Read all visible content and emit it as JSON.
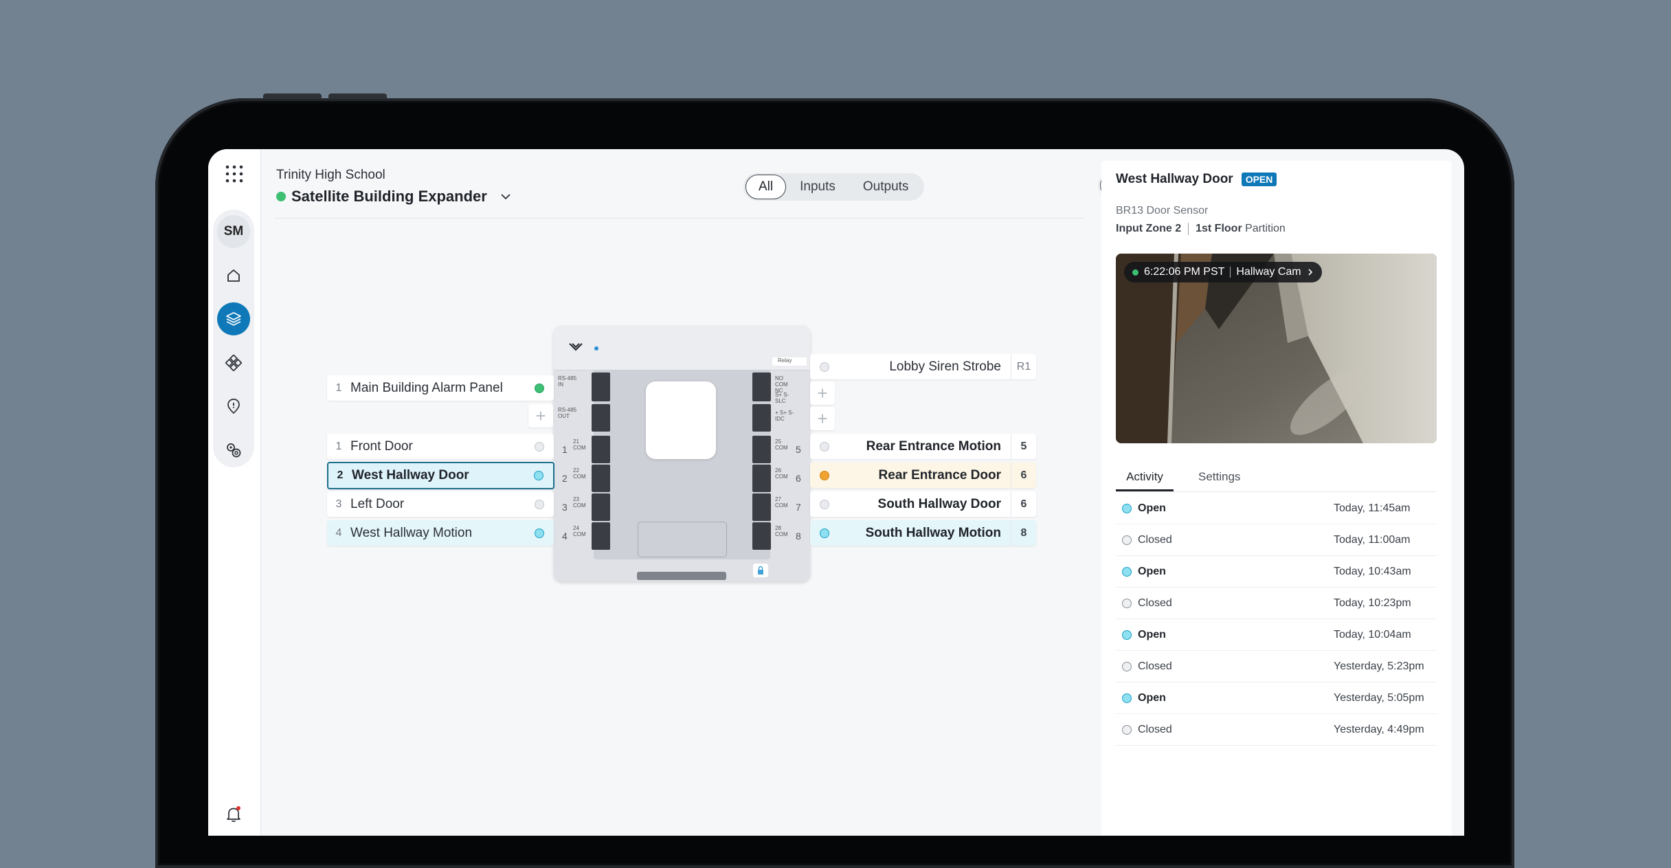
{
  "header": {
    "org_name": "Trinity High School",
    "device_name": "Satellite Building Expander",
    "status_color": "#3dbf74"
  },
  "filter_tabs": [
    {
      "label": "All",
      "active": true
    },
    {
      "label": "Inputs",
      "active": false
    },
    {
      "label": "Outputs",
      "active": false
    }
  ],
  "sidebar": {
    "avatar_initials": "SM",
    "items": [
      {
        "icon": "home-icon",
        "active": false
      },
      {
        "icon": "devices-icon",
        "active": true
      },
      {
        "icon": "integrations-icon",
        "active": false
      },
      {
        "icon": "location-icon",
        "active": false
      },
      {
        "icon": "settings-icon",
        "active": false
      }
    ]
  },
  "left_ports": [
    {
      "num": "1",
      "label": "Main Building Alarm Panel",
      "indicator": "green"
    },
    {
      "num": "1",
      "label": "Front Door",
      "indicator": "gray"
    },
    {
      "num": "2",
      "label": "West Hallway Door",
      "indicator": "cyan",
      "selected": true
    },
    {
      "num": "3",
      "label": "Left Door",
      "indicator": "gray"
    },
    {
      "num": "4",
      "label": "West Hallway Motion",
      "indicator": "cyan"
    }
  ],
  "right_ports": [
    {
      "label": "Lobby Siren Strobe",
      "tag": "R1",
      "indicator": "gray"
    },
    {
      "label": "Rear Entrance Motion",
      "tag": "5",
      "indicator": "gray"
    },
    {
      "label": "Rear Entrance Door",
      "tag": "6",
      "indicator": "orange"
    },
    {
      "label": "South Hallway Door",
      "tag": "6",
      "indicator": "gray"
    },
    {
      "label": "South Hallway Motion",
      "tag": "8",
      "indicator": "cyan"
    }
  ],
  "board": {
    "zone_left": [
      "1",
      "2",
      "3",
      "4"
    ],
    "zone_right": [
      "5",
      "6",
      "7",
      "8"
    ],
    "term_left": [
      "RS-485 IN",
      "RS-485 OUT",
      "21 COM",
      "22 COM",
      "23 COM",
      "24 COM"
    ],
    "term_right": [
      "NO COM NC",
      "S+ S- SLC",
      "+ S+ S- IDC",
      "25 COM",
      "26 COM",
      "27 COM",
      "28 COM"
    ],
    "relay_label": "Relay"
  },
  "panel": {
    "title": "West Hallway Door",
    "badge": "OPEN",
    "subtitle": "BR13 Door Sensor",
    "zone": "Input Zone 2",
    "floor_bold": "1st Floor",
    "floor_rest": "Partition",
    "camera_time": "6:22:06 PM PST",
    "camera_name": "Hallway Cam",
    "tabs": [
      {
        "label": "Activity",
        "active": true
      },
      {
        "label": "Settings",
        "active": false
      }
    ],
    "activity": [
      {
        "state": "Open",
        "time": "Today, 11:45am",
        "type": "open"
      },
      {
        "state": "Closed",
        "time": "Today, 11:00am",
        "type": "closed"
      },
      {
        "state": "Open",
        "time": "Today, 10:43am",
        "type": "open"
      },
      {
        "state": "Closed",
        "time": "Today, 10:23pm",
        "type": "closed"
      },
      {
        "state": "Open",
        "time": "Today, 10:04am",
        "type": "open"
      },
      {
        "state": "Closed",
        "time": "Yesterday, 5:23pm",
        "type": "closed"
      },
      {
        "state": "Open",
        "time": "Yesterday, 5:05pm",
        "type": "open"
      },
      {
        "state": "Closed",
        "time": "Yesterday, 4:49pm",
        "type": "closed"
      }
    ]
  },
  "colors": {
    "accent": "#0e78b8",
    "open": "#8ee0f0",
    "warning": "#f0a32e",
    "online": "#3dbf74"
  }
}
